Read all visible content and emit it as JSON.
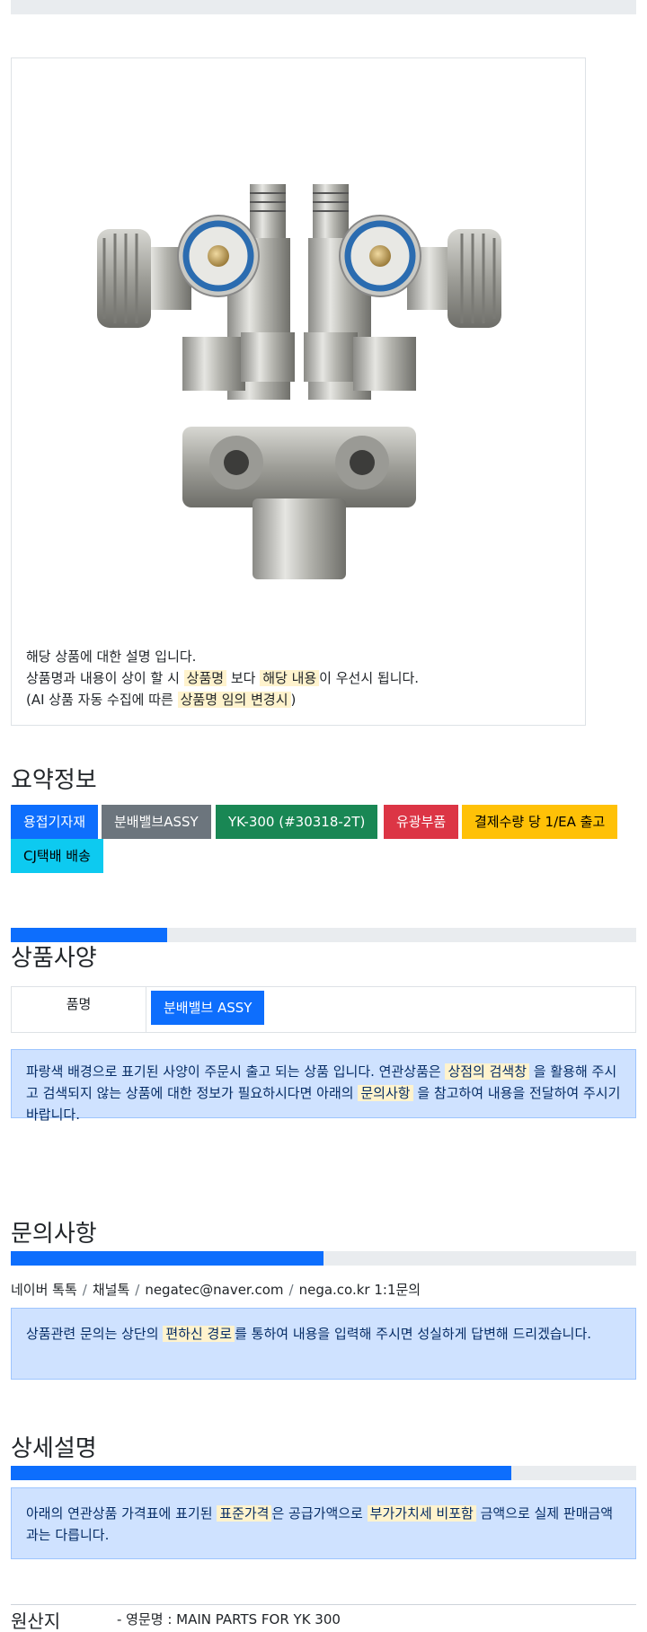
{
  "product": {
    "image_alt": "분배밸브ASSY",
    "desc_line1": "해당 상품에 대한 설명 입니다.",
    "desc_line2_a": "상품명과 내용이 상이 할 시 ",
    "desc_line2_hl1": "상품명",
    "desc_line2_b": " 보다 ",
    "desc_line2_hl2": "해당 내용",
    "desc_line2_c": "이 우선시 됩니다.",
    "desc_line3_a": "(AI 상품 자동 수집에 따른 ",
    "desc_line3_hl": "상품명 임의 변경시",
    "desc_line3_b": ")"
  },
  "summary": {
    "title": "요약정보",
    "badges": [
      {
        "label": "용접기자재",
        "color": "#0d6efd",
        "text_color": "#ffffff"
      },
      {
        "label": "분배밸브ASSY",
        "color": "#6c757d",
        "text_color": "#ffffff"
      },
      {
        "label": "YK-300 (#30318-2T)",
        "color": "#198754",
        "text_color": "#ffffff"
      },
      {
        "label": "유광부품",
        "color": "#dc3545",
        "text_color": "#ffffff"
      },
      {
        "label": "결제수량 당 1/EA 출고",
        "color": "#ffc107",
        "text_color": "#000000"
      },
      {
        "label": "CJ택배 배송",
        "color": "#0dcaf0",
        "text_color": "#000000"
      }
    ]
  },
  "spec": {
    "title": "상품사양",
    "progress": 0.25,
    "label": "품명",
    "value": "분배밸브 ASSY",
    "notice_a": "파랑색 배경으로 표기된 사양이 주문시 출고 되는 상품 입니다. 연관상품은 ",
    "notice_hl1": "상점의 검색창",
    "notice_b": " 을 활용해 주시고 검색되지 않는 상품에 대한 정보가 필요하시다면 아래의 ",
    "notice_hl2": "문의사항",
    "notice_c": " 을 참고하여 내용을 전달하여 주시기 바랍니다."
  },
  "inquiry": {
    "title": "문의사항",
    "progress": 0.5,
    "channels": [
      "네이버 톡톡",
      "채널톡",
      "negatec@naver.com",
      "nega.co.kr 1:1문의"
    ],
    "separator": "/",
    "notice_a": "상품관련 문의는 상단의 ",
    "notice_hl": "편하신 경로",
    "notice_b": "를 통하여 내용을 입력해 주시면 성실하게 답변해 드리겠습니다."
  },
  "detail": {
    "title": "상세설명",
    "progress": 0.8,
    "notice_a": "아래의 연관상품 가격표에 표기된 ",
    "notice_hl1": "표준가격",
    "notice_b": "은 공급가액으로 ",
    "notice_hl2": "부가가치세 비포함",
    "notice_c": " 금액으로 실제 판매금액과는 다릅니다."
  },
  "origin": {
    "label": "원산지",
    "value": "- 영문명 : MAIN PARTS FOR YK 300"
  },
  "colors": {
    "primary": "#0d6efd",
    "highlight": "#fff3cd",
    "alert_bg": "#cfe2ff",
    "alert_border": "#9ec5fe"
  }
}
